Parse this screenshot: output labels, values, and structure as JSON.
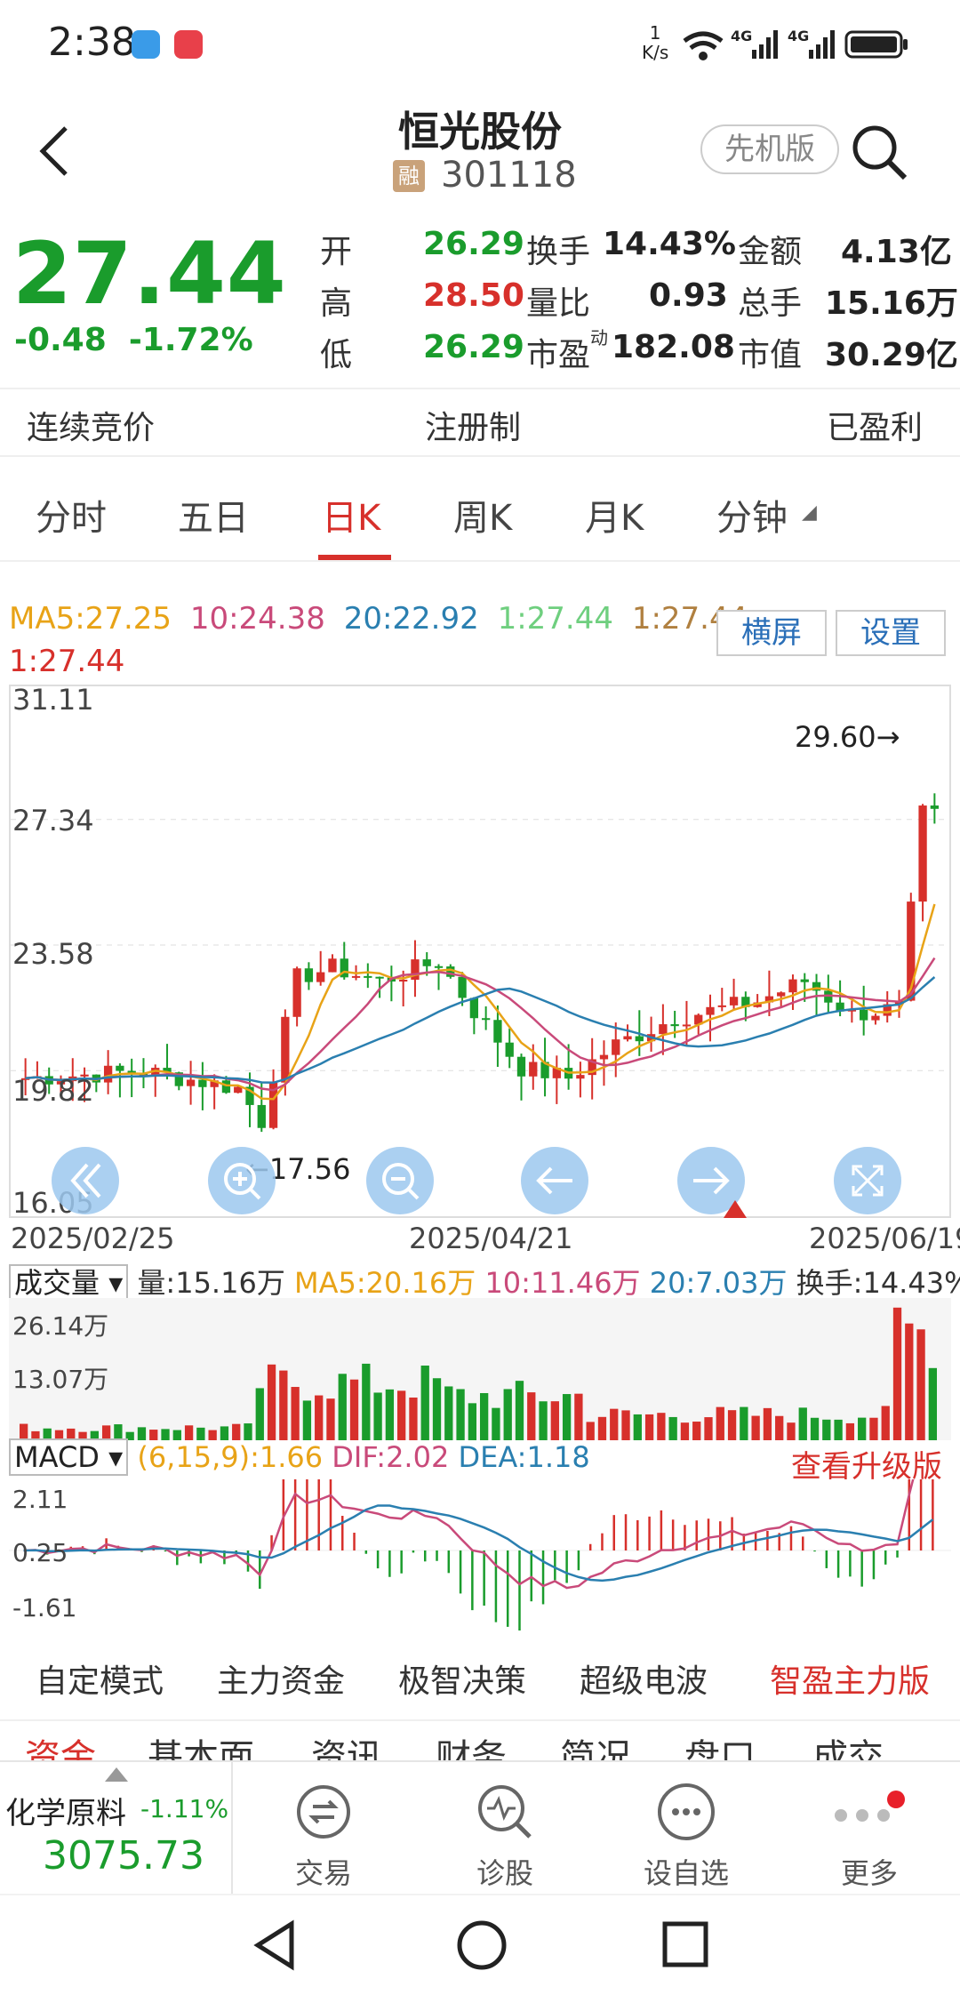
{
  "status": {
    "time": "2:38",
    "net_rate_top": "1",
    "net_rate_bottom": "K/s",
    "sig1": "4G",
    "sig2": "4G"
  },
  "header": {
    "title": "恒光股份",
    "badge": "融",
    "code": "301118",
    "version_btn": "先机版"
  },
  "quote": {
    "price": "27.44",
    "change": "-0.48",
    "change_pct": "-1.72%",
    "rows": [
      [
        {
          "l": "开",
          "v": "26.29",
          "c": "green"
        },
        {
          "l": "换手",
          "v": "14.43%",
          "c": "blk"
        },
        {
          "l": "金额",
          "v": "4.13亿",
          "c": "blk"
        }
      ],
      [
        {
          "l": "高",
          "v": "28.50",
          "c": "red"
        },
        {
          "l": "量比",
          "v": "0.93",
          "c": "blk"
        },
        {
          "l": "总手",
          "v": "15.16万",
          "c": "blk"
        }
      ],
      [
        {
          "l": "低",
          "v": "26.29",
          "c": "green"
        },
        {
          "l": "市盈",
          "sup": "动",
          "v": "182.08",
          "c": "blk"
        },
        {
          "l": "市值",
          "v": "30.29亿",
          "c": "blk"
        }
      ]
    ]
  },
  "tags": {
    "left": "连续竞价",
    "mid": "注册制",
    "right": "已盈利"
  },
  "tabs": [
    "分时",
    "五日",
    "日K",
    "周K",
    "月K",
    "分钟"
  ],
  "ma": {
    "ma5": "MA5:27.25",
    "ma10": "10:24.38",
    "ma20": "20:22.92",
    "ma1a": "1:27.44",
    "ma1b": "1:27.44",
    "ma1c": "1:27.44"
  },
  "buttons": {
    "landscape": "横屏",
    "settings": "设置"
  },
  "kline": {
    "y_ticks": [
      "31.11",
      "27.34",
      "23.58",
      "19.82",
      "16.05"
    ],
    "dates": [
      "2025/02/25",
      "2025/04/21",
      "2025/06/19"
    ],
    "high_mark": "29.60→",
    "low_mark": "←17.56"
  },
  "volume": {
    "selector": "成交量",
    "vol": "量:15.16万",
    "ma5": "MA5:20.16万",
    "ma10": "10:11.46万",
    "ma20": "20:7.03万",
    "turnover": "换手:14.43%",
    "y_ticks": [
      "26.14万",
      "13.07万"
    ]
  },
  "macd": {
    "selector": "MACD",
    "params": "(6,15,9):1.66",
    "dif": "DIF:2.02",
    "dea": "DEA:1.18",
    "upgrade": "查看升级版",
    "y_ticks": [
      "2.11",
      "0.25",
      "-1.61"
    ]
  },
  "modes": [
    "自定模式",
    "主力资金",
    "极智决策",
    "超级电波",
    "智盈主力版"
  ],
  "subtabs": [
    "资金",
    "基本面",
    "资讯",
    "财务",
    "简况",
    "盘口",
    "成交"
  ],
  "index": {
    "name": "化学原料",
    "pct": "-1.11%",
    "value": "3075.73"
  },
  "bottom_nav": [
    "交易",
    "诊股",
    "设自选",
    "更多"
  ],
  "colors": {
    "up": "#d7302b",
    "down": "#1a9c2c",
    "ma5": "#e8a317",
    "ma10": "#c94a7a",
    "ma20": "#2a7fb0",
    "accent": "#d7302b"
  }
}
